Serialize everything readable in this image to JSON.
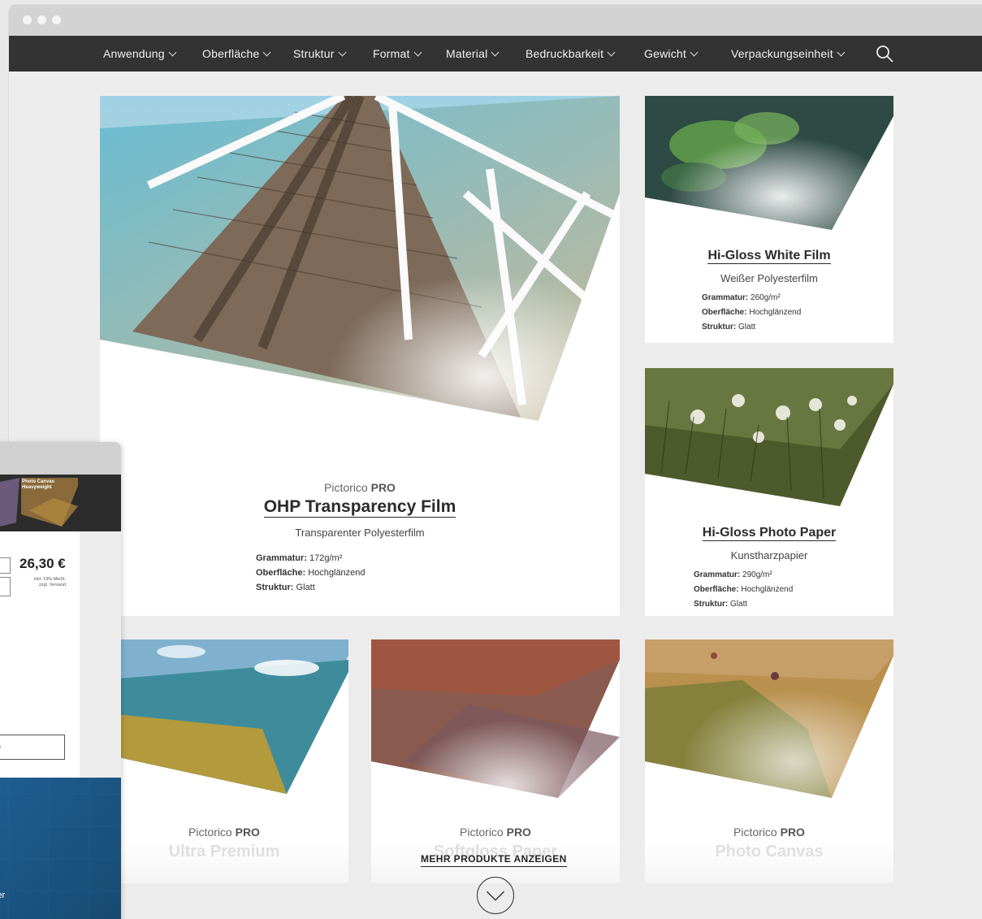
{
  "nav": {
    "items": [
      {
        "label": "Anwendung"
      },
      {
        "label": "Oberfläche"
      },
      {
        "label": "Struktur"
      },
      {
        "label": "Format"
      },
      {
        "label": "Material"
      },
      {
        "label": "Bedruckbarkeit"
      },
      {
        "label": "Gewicht"
      },
      {
        "label": "Verpackungseinheit"
      }
    ],
    "search_icon": "search-icon"
  },
  "featured": {
    "brand_prefix": "Pictorico",
    "brand_suffix": "PRO",
    "title": "OHP Transparency Film",
    "subtitle": "Transparenter Polyesterfilm",
    "specs": [
      {
        "key": "Grammatur:",
        "value": "172g/m²"
      },
      {
        "key": "Oberfläche:",
        "value": "Hochglänzend"
      },
      {
        "key": "Struktur:",
        "value": "Glatt"
      }
    ]
  },
  "products": [
    {
      "title": "Hi-Gloss White Film",
      "subtitle": "Weißer Polyesterfilm",
      "specs": [
        {
          "key": "Grammatur:",
          "value": "260g/m²"
        },
        {
          "key": "Oberfläche:",
          "value": "Hochglänzend"
        },
        {
          "key": "Struktur:",
          "value": "Glatt"
        }
      ]
    },
    {
      "title": "Hi-Gloss Photo Paper",
      "subtitle": "Kunstharzpapier",
      "specs": [
        {
          "key": "Grammatur:",
          "value": "290g/m²"
        },
        {
          "key": "Oberfläche:",
          "value": "Hochglänzend"
        },
        {
          "key": "Struktur:",
          "value": "Glatt"
        }
      ]
    }
  ],
  "bottom_cards": [
    {
      "brand_prefix": "Pictorico",
      "brand_suffix": "PRO",
      "title_fragment": "Ultra Premium"
    },
    {
      "brand_prefix": "Pictorico",
      "brand_suffix": "PRO",
      "title_fragment": "Softgloss Paper"
    },
    {
      "brand_prefix": "Pictorico",
      "brand_suffix": "PRO",
      "title_fragment": "Photo Canvas"
    }
  ],
  "more_button": {
    "label": "MEHR PRODUKTE ANZEIGEN",
    "icon": "chevron-down-circle-icon"
  },
  "secondary_window": {
    "thumb_label_line1": "Photo Canvas",
    "thumb_label_line2": "Heavyweight",
    "price": "26,30 €",
    "tax_line1": "inkl. 19% MwSt.",
    "tax_line2": "zzgl. Versand",
    "button_fragment": "en",
    "footer_fragment": "ier"
  },
  "colors": {
    "navbar": "#333333",
    "background": "#ececec",
    "accent_blue": "#1f5f93"
  }
}
